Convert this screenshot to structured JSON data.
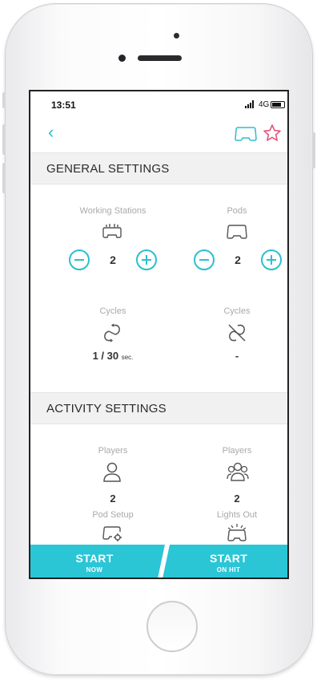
{
  "status_bar": {
    "time": "13:51",
    "network": "4G"
  },
  "nav": {
    "back_icon": "chevron-left-icon",
    "pod_icon": "pod-icon",
    "favorite_icon": "star-icon"
  },
  "sections": {
    "general": "GENERAL SETTINGS",
    "activity": "ACTIVITY SETTINGS"
  },
  "general": {
    "working_stations": {
      "label": "Working Stations",
      "value": "2",
      "icon": "working-stations-icon"
    },
    "pods": {
      "label": "Pods",
      "value": "2",
      "icon": "pod-icon"
    },
    "cycles_left": {
      "label": "Cycles",
      "value": "1 / 30",
      "unit": "sec.",
      "icon": "cycle-icon"
    },
    "cycles_right": {
      "label": "Cycles",
      "value": "-",
      "icon": "no-cycle-icon"
    }
  },
  "activity": {
    "players_single": {
      "label": "Players",
      "value": "2",
      "icon": "user-icon"
    },
    "players_group": {
      "label": "Players",
      "value": "2",
      "icon": "group-icon"
    },
    "pod_setup": {
      "label": "Pod Setup",
      "icon": "pod-setup-icon"
    },
    "lights_out": {
      "label": "Lights Out",
      "icon": "lights-out-icon"
    }
  },
  "cta": {
    "start_now": {
      "title": "START",
      "sub": "NOW"
    },
    "start_on_hit": {
      "title": "START",
      "sub": "ON HIT"
    }
  },
  "colors": {
    "accent": "#2bc6d6",
    "favorite": "#e0557a",
    "header_bg": "#f1f1f2"
  }
}
